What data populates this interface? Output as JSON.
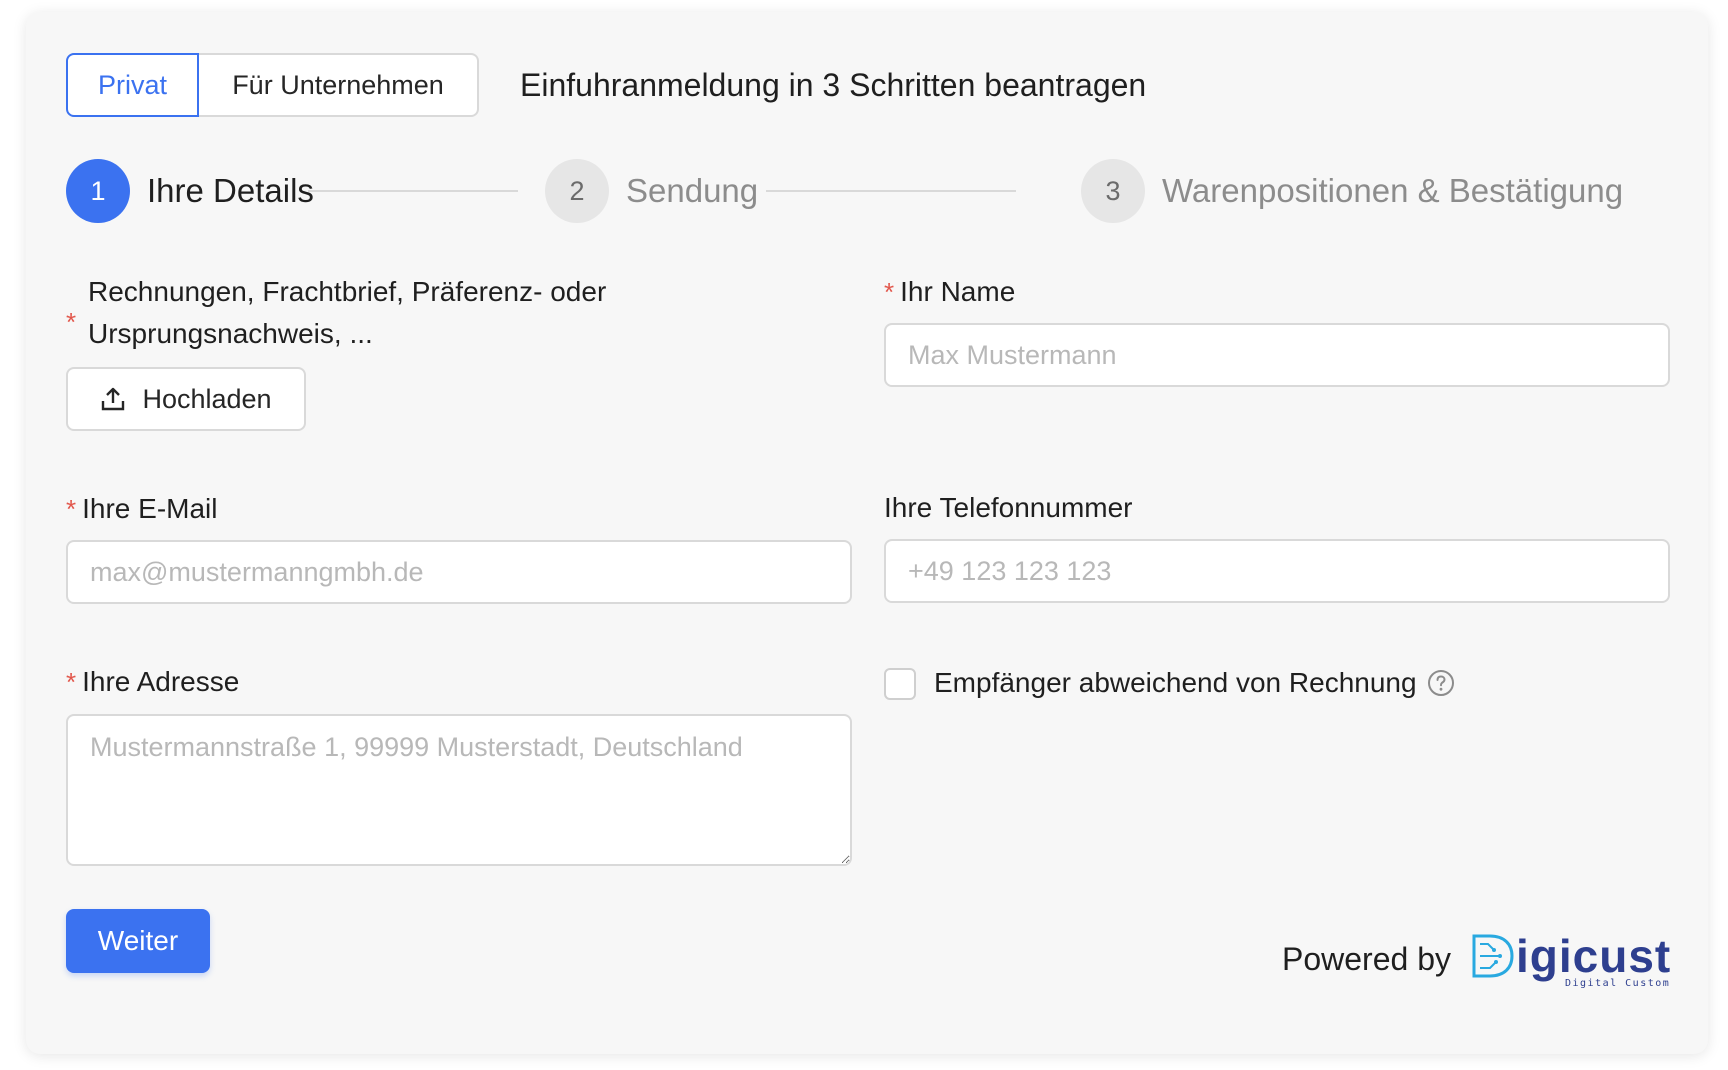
{
  "mode_toggle": {
    "options": [
      "Privat",
      "Für Unternehmen"
    ],
    "selected": "Privat"
  },
  "heading": "Einfuhranmeldung in 3 Schritten beantragen",
  "steps": [
    {
      "number": "1",
      "label": "Ihre Details",
      "state": "active"
    },
    {
      "number": "2",
      "label": "Sendung",
      "state": "inactive"
    },
    {
      "number": "3",
      "label": "Warenpositionen & Bestätigung",
      "state": "inactive"
    }
  ],
  "form": {
    "documents": {
      "label_line1": "Rechnungen, Frachtbrief, Präferenz- oder",
      "label_line2": "Ursprungsnachweis, ...",
      "required_mark": "*",
      "upload_label": "Hochladen"
    },
    "name": {
      "label": "Ihr Name",
      "required_mark": "*",
      "placeholder": "Max Mustermann",
      "value": ""
    },
    "email": {
      "label": "Ihre E-Mail",
      "required_mark": "*",
      "placeholder": "max@mustermanngmbh.de",
      "value": ""
    },
    "phone": {
      "label": "Ihre Telefonnummer",
      "placeholder": "+49 123 123 123",
      "value": ""
    },
    "address": {
      "label": "Ihre Adresse",
      "required_mark": "*",
      "placeholder": "Mustermannstraße 1, 99999 Musterstadt, Deutschland",
      "value": ""
    },
    "recipient_checkbox": {
      "label": "Empfänger abweichend von Rechnung",
      "checked": false,
      "help_icon": "question-circle-icon"
    },
    "submit_label": "Weiter"
  },
  "footer": {
    "powered_by": "Powered by",
    "logo_text": "Digicust",
    "logo_subtext": "Digital Customs"
  },
  "colors": {
    "primary": "#3b72f0",
    "required": "#e2574c",
    "card_bg": "#f7f7f7",
    "logo_blue": "#29a9e0",
    "logo_dark": "#2e3f8f"
  }
}
